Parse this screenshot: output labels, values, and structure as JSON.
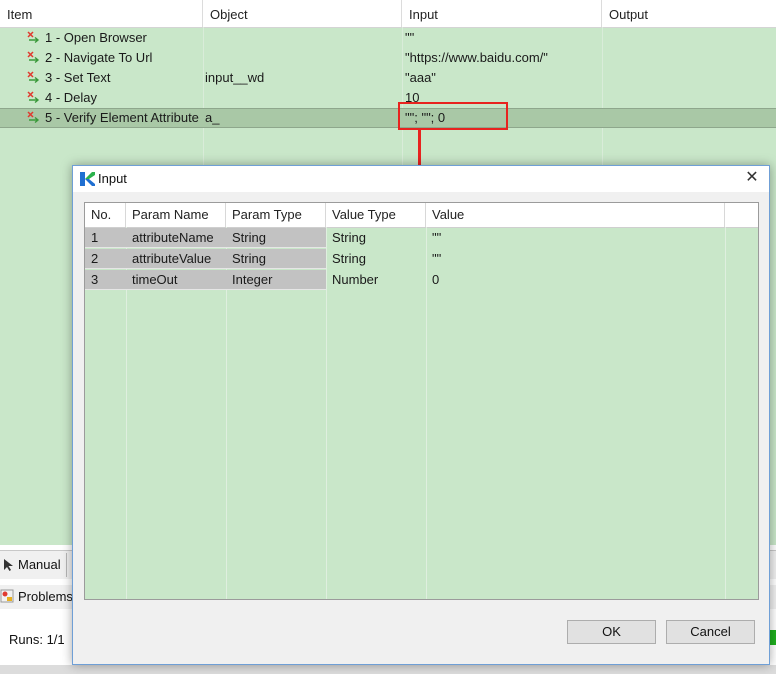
{
  "main_table": {
    "columns": [
      "Item",
      "Object",
      "Input",
      "Output"
    ],
    "rows": [
      {
        "item": "1 - Open Browser",
        "object": "",
        "input": "\"\"",
        "output": ""
      },
      {
        "item": "2 - Navigate To Url",
        "object": "",
        "input": "\"https://www.baidu.com/\"",
        "output": ""
      },
      {
        "item": "3 - Set Text",
        "object": "input__wd",
        "input": "\"aaa\"",
        "output": ""
      },
      {
        "item": "4 - Delay",
        "object": "",
        "input": "10",
        "output": ""
      },
      {
        "item": "5 - Verify Element Attribute",
        "object": "a_",
        "input": "\"\"; \"\"; 0",
        "output": ""
      }
    ]
  },
  "bottom": {
    "manual_tab": "Manual",
    "problems_tab": "Problems",
    "runs_label": "Runs: 1/1"
  },
  "dialog": {
    "title": "Input",
    "columns": [
      "No.",
      "Param Name",
      "Param Type",
      "Value Type",
      "Value"
    ],
    "rows": [
      {
        "no": "1",
        "name": "attributeName",
        "type": "String",
        "value_type": "String",
        "value": "\"\""
      },
      {
        "no": "2",
        "name": "attributeValue",
        "type": "String",
        "value_type": "String",
        "value": "\"\""
      },
      {
        "no": "3",
        "name": "timeOut",
        "type": "Integer",
        "value_type": "Number",
        "value": "0"
      }
    ],
    "ok_label": "OK",
    "cancel_label": "Cancel"
  },
  "colors": {
    "row_green": "#c9e7c9",
    "selected_row": "#a9c8a6",
    "highlight": "#e8231f",
    "logo_green": "#2bb24c",
    "logo_blue": "#1f6fd1"
  },
  "icons": {
    "step": "step-arrow-icon",
    "manual": "cursor-icon",
    "problems": "problems-icon",
    "dialog_logo": "katalon-logo-icon",
    "close": "close-icon"
  }
}
